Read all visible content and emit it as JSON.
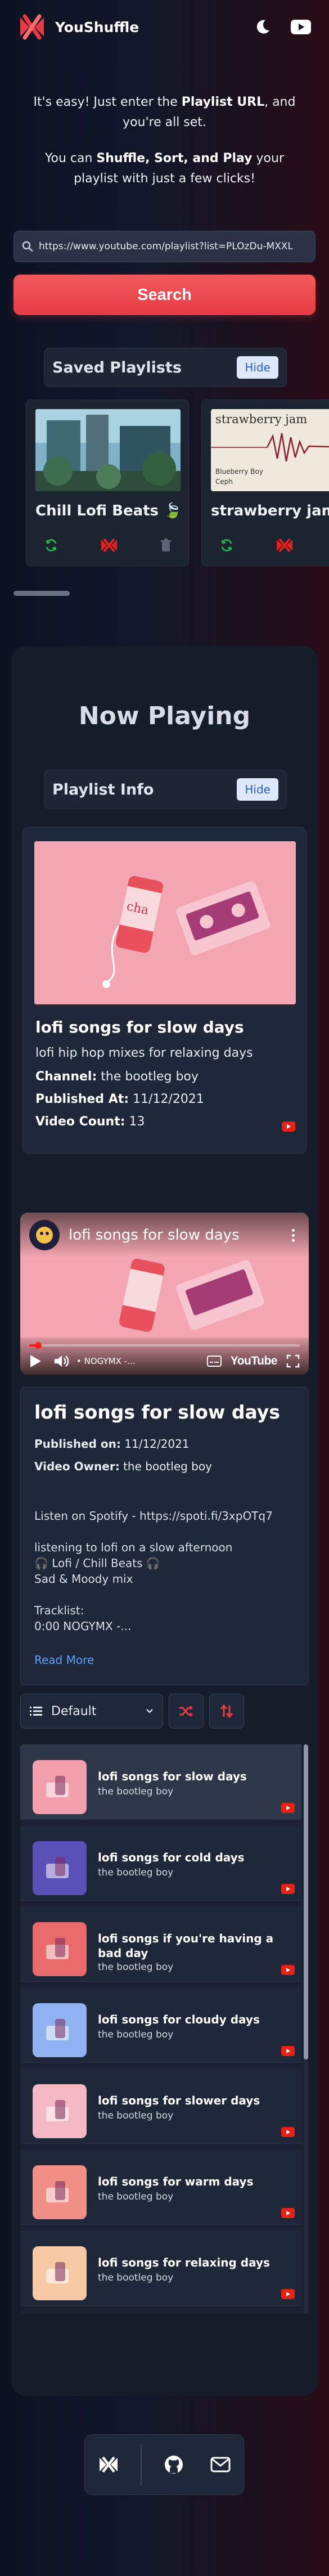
{
  "header": {
    "title": "YouShuffle",
    "theme_icon": "moon-icon",
    "youtube_icon": "youtube-icon"
  },
  "intro": {
    "line1_a": "It's easy! Just enter the ",
    "line1_b": "Playlist URL",
    "line1_c": ", and you're all set.",
    "line2_a": "You can ",
    "line2_b": "Shuffle, Sort, and Play",
    "line2_c": " your playlist with just a few clicks!"
  },
  "search": {
    "value": "https://www.youtube.com/playlist?list=PLOzDu-MXXL",
    "button_label": "Search"
  },
  "saved": {
    "title": "Saved Playlists",
    "hide_label": "Hide",
    "items": [
      {
        "name": "Chill Lofi Beats 🍃"
      },
      {
        "name": "strawberry jam",
        "thumb_text": "strawberry jam",
        "thumb_sub1": "Blueberry Boy",
        "thumb_sub2": "Ceph"
      }
    ]
  },
  "now_playing": {
    "title": "Now Playing",
    "info_bar_title": "Playlist Info",
    "hide_label": "Hide",
    "playlist": {
      "title": "lofi songs for slow days",
      "subtitle": "lofi hip hop mixes for relaxing days",
      "channel_label": "Channel:",
      "channel": "the bootleg boy",
      "published_label": "Published At:",
      "published": "11/12/2021",
      "count_label": "Video Count:",
      "count": "13"
    }
  },
  "player": {
    "video_title": "lofi songs for slow days",
    "chapter": "• NOGYMX -...",
    "youtube_word": "YouTube",
    "progress": 0.03
  },
  "video_desc": {
    "title": "lofi songs for slow days",
    "published_label": "Published on:",
    "published": "11/12/2021",
    "owner_label": "Video Owner:",
    "owner": "the bootleg boy",
    "text": "Listen on Spotify - https://spoti.fi/3xpOTq7\n\nlistening to lofi on a slow afternoon\n🎧 Lofi / Chill Beats 🎧\nSad & Moody mix\n\nTracklist:\n0:00 NOGYMX -...",
    "read_more": "Read More"
  },
  "controls": {
    "sort_value": "Default",
    "shuffle_icon": "shuffle-icon",
    "reverse_icon": "reverse-sort-icon"
  },
  "tracks": [
    {
      "title": "lofi songs for slow days",
      "owner": "the bootleg boy",
      "color": "#f2a0ad",
      "active": true
    },
    {
      "title": "lofi songs for cold days",
      "owner": "the bootleg boy",
      "color": "#5b4fb8"
    },
    {
      "title": "lofi songs if you're having a bad day",
      "owner": "the bootleg boy",
      "color": "#e86a6a"
    },
    {
      "title": "lofi songs for cloudy days",
      "owner": "the bootleg boy",
      "color": "#8fb3f0"
    },
    {
      "title": "lofi songs for slower days",
      "owner": "the bootleg boy",
      "color": "#f4b8c2"
    },
    {
      "title": "lofi songs for warm days",
      "owner": "the bootleg boy",
      "color": "#ef8f86"
    },
    {
      "title": "lofi songs for relaxing days",
      "owner": "the bootleg boy",
      "color": "#f6c9a6"
    }
  ],
  "colors": {
    "accent_red": "#e83a45",
    "link_blue": "#5ea0ff",
    "youtube_red": "#e62117",
    "shuffle_green": "#22b14c"
  },
  "footer": {
    "icons": [
      "youshuffle-logo-icon",
      "github-icon",
      "mail-icon"
    ]
  }
}
